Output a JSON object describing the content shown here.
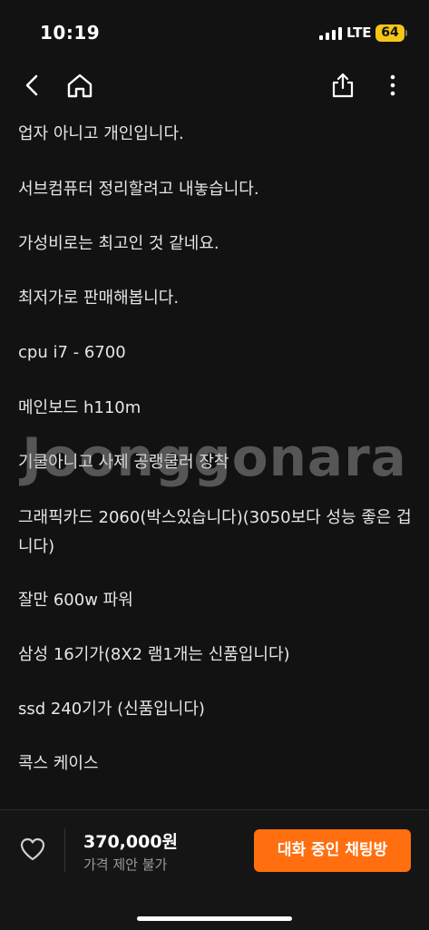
{
  "status_bar": {
    "time": "10:19",
    "network": "LTE",
    "battery": "64"
  },
  "nav": {
    "back_icon": "chevron-left-icon",
    "home_icon": "home-icon",
    "share_icon": "share-icon",
    "more_icon": "more-vertical-icon"
  },
  "description": {
    "lines": [
      "업자 아니고 개인입니다.",
      "서브컴퓨터 정리할려고 내놓습니다.",
      "가성비로는 최고인 것 같네요.",
      "최저가로 판매해봅니다.",
      "cpu i7 - 6700",
      "메인보드 h110m",
      "기쿨아니고 사제 공랭쿨러 장착",
      "그래픽카드 2060(박스있습니다)(3050보다 성능 좋은 겁니다)",
      "잘만 600w 파워",
      "삼성 16기가(8X2 램1개는 신품입니다)",
      "ssd 240기가 (신품입니다)",
      "콕스 케이스"
    ]
  },
  "watermark": "Joonggonara",
  "bottom_bar": {
    "price": "370,000원",
    "price_note": "가격 제안 불가",
    "chat_button_label": "대화 중인 채팅방",
    "accent_color": "#ff6f0f"
  }
}
